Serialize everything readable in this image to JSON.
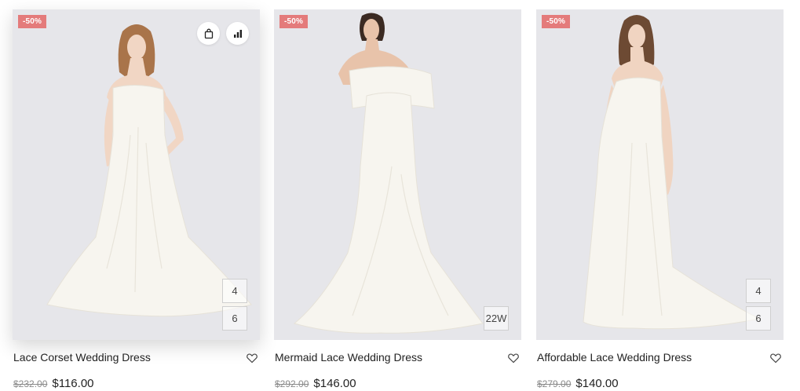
{
  "products": [
    {
      "name": "Lace Corset Wedding Dress",
      "badge": "-50%",
      "old_price": "$232.00",
      "price": "$116.00",
      "sizes": [
        "4",
        "6"
      ],
      "hair_color": "#a9744a"
    },
    {
      "name": "Mermaid Lace Wedding Dress",
      "badge": "-50%",
      "old_price": "$292.00",
      "price": "$146.00",
      "sizes": [
        "22W"
      ],
      "hair_color": "#3b2a22"
    },
    {
      "name": "Affordable Lace Wedding Dress",
      "badge": "-50%",
      "old_price": "$279.00",
      "price": "$140.00",
      "sizes": [
        "4",
        "6"
      ],
      "hair_color": "#6d4a33"
    }
  ],
  "actions": [
    "shopping-bag-icon",
    "compare-chart-icon"
  ],
  "colors": {
    "badge": "#e47b7b",
    "image_bg": "#e6e6ea",
    "dress": "#f7f5ef"
  }
}
